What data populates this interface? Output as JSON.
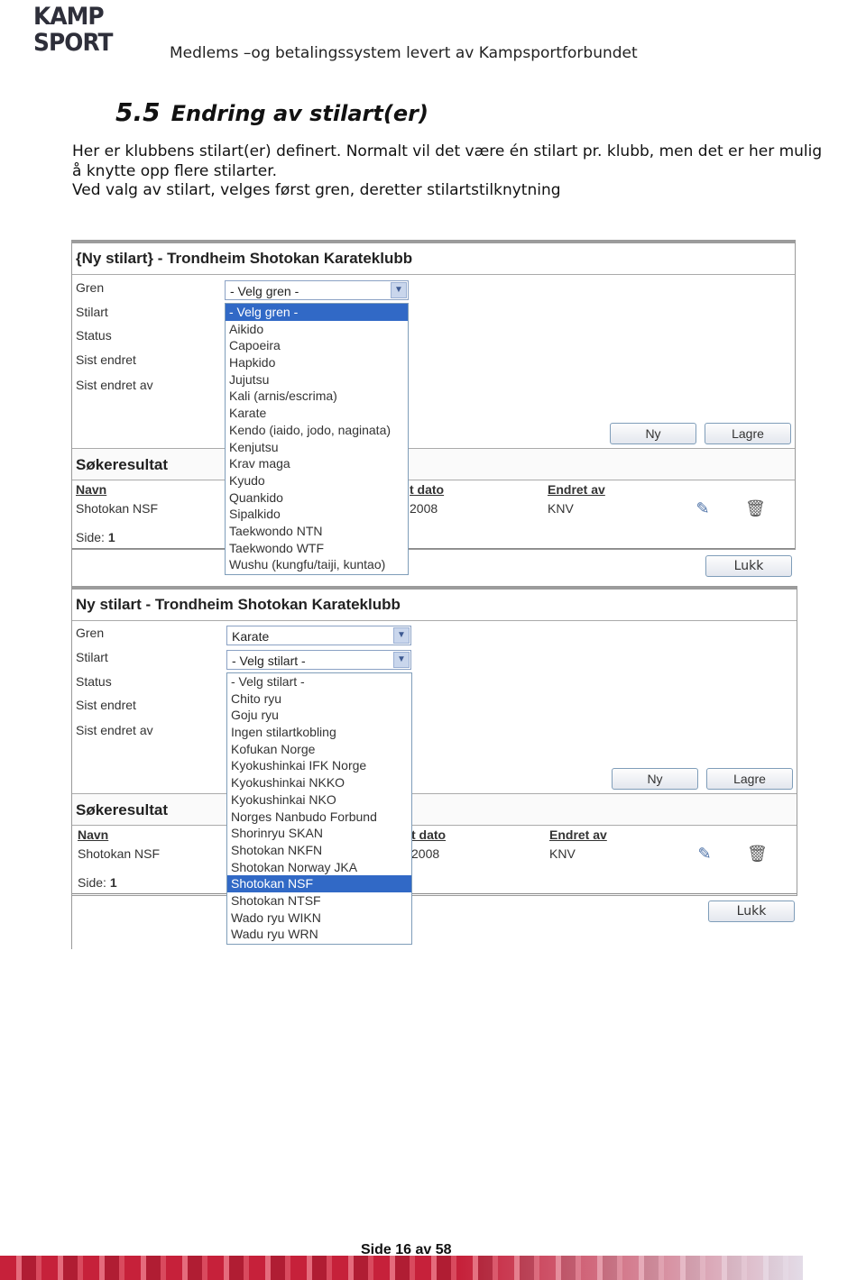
{
  "logo": {
    "line1": "KAMP",
    "line2": "SPORT"
  },
  "header": {
    "text": "Medlems –og betalingssystem levert av Kampsportforbundet"
  },
  "section": {
    "number": "5.5",
    "title": "Endring av stilart(er)"
  },
  "paragraph": {
    "line1": "Her er klubbens stilart(er) definert. Normalt vil det være én stilart pr. klubb, men det er her mulig",
    "line2": "å knytte opp flere stilarter.",
    "line3": "Ved valg av stilart, velges først gren, deretter stilartstilknytning"
  },
  "screen1": {
    "title": "{Ny stilart} - Trondheim Shotokan Karateklubb",
    "labels": [
      "Gren",
      "Stilart",
      "Status",
      "Sist endret",
      "Sist endret av"
    ],
    "gren_select": "- Velg gren -",
    "buttons": {
      "ny": "Ny",
      "lagre": "Lagre",
      "lukk": "Lukk"
    },
    "results_title": "Søkeresultat",
    "col_navn": "Navn",
    "col_dato": "t dato",
    "col_endret_av": "Endret av",
    "row": {
      "navn": "Shotokan NSF",
      "dato": "2008",
      "endret_av": "KNV"
    },
    "side_label": "Side:",
    "side_value": "1",
    "dropdown": [
      "- Velg gren -",
      "Aikido",
      "Capoeira",
      "Hapkido",
      "Jujutsu",
      "Kali (arnis/escrima)",
      "Karate",
      "Kendo (iaido, jodo, naginata)",
      "Kenjutsu",
      "Krav maga",
      "Kyudo",
      "Quankido",
      "Sipalkido",
      "Taekwondo NTN",
      "Taekwondo WTF",
      "Wushu (kungfu/taiji, kuntao)"
    ],
    "dropdown_selected": "- Velg gren -"
  },
  "screen2": {
    "title": "Ny stilart - Trondheim Shotokan Karateklubb",
    "labels": [
      "Gren",
      "Stilart",
      "Status",
      "Sist endret",
      "Sist endret av"
    ],
    "gren_select": "Karate",
    "stilart_select": "- Velg stilart -",
    "buttons": {
      "ny": "Ny",
      "lagre": "Lagre",
      "lukk": "Lukk"
    },
    "results_title": "Søkeresultat",
    "col_navn": "Navn",
    "col_dato": "t dato",
    "col_endret_av": "Endret av",
    "row": {
      "navn": "Shotokan NSF",
      "dato": "2008",
      "endret_av": "KNV"
    },
    "side_label": "Side:",
    "side_value": "1",
    "dropdown": [
      "- Velg stilart -",
      "Chito ryu",
      "Goju ryu",
      "Ingen stilartkobling",
      "Kofukan Norge",
      "Kyokushinkai IFK Norge",
      "Kyokushinkai NKKO",
      "Kyokushinkai NKO",
      "Norges Nanbudo Forbund",
      "Shorinryu SKAN",
      "Shotokan NKFN",
      "Shotokan Norway JKA",
      "Shotokan NSF",
      "Shotokan NTSF",
      "Wado ryu WIKN",
      "Wadu ryu WRN"
    ],
    "dropdown_selected": "Shotokan NSF"
  },
  "footer": {
    "page_text": "Side 16 av 58"
  },
  "colors": {
    "selection": "#3169c6",
    "footer_band": "#c6213a"
  }
}
